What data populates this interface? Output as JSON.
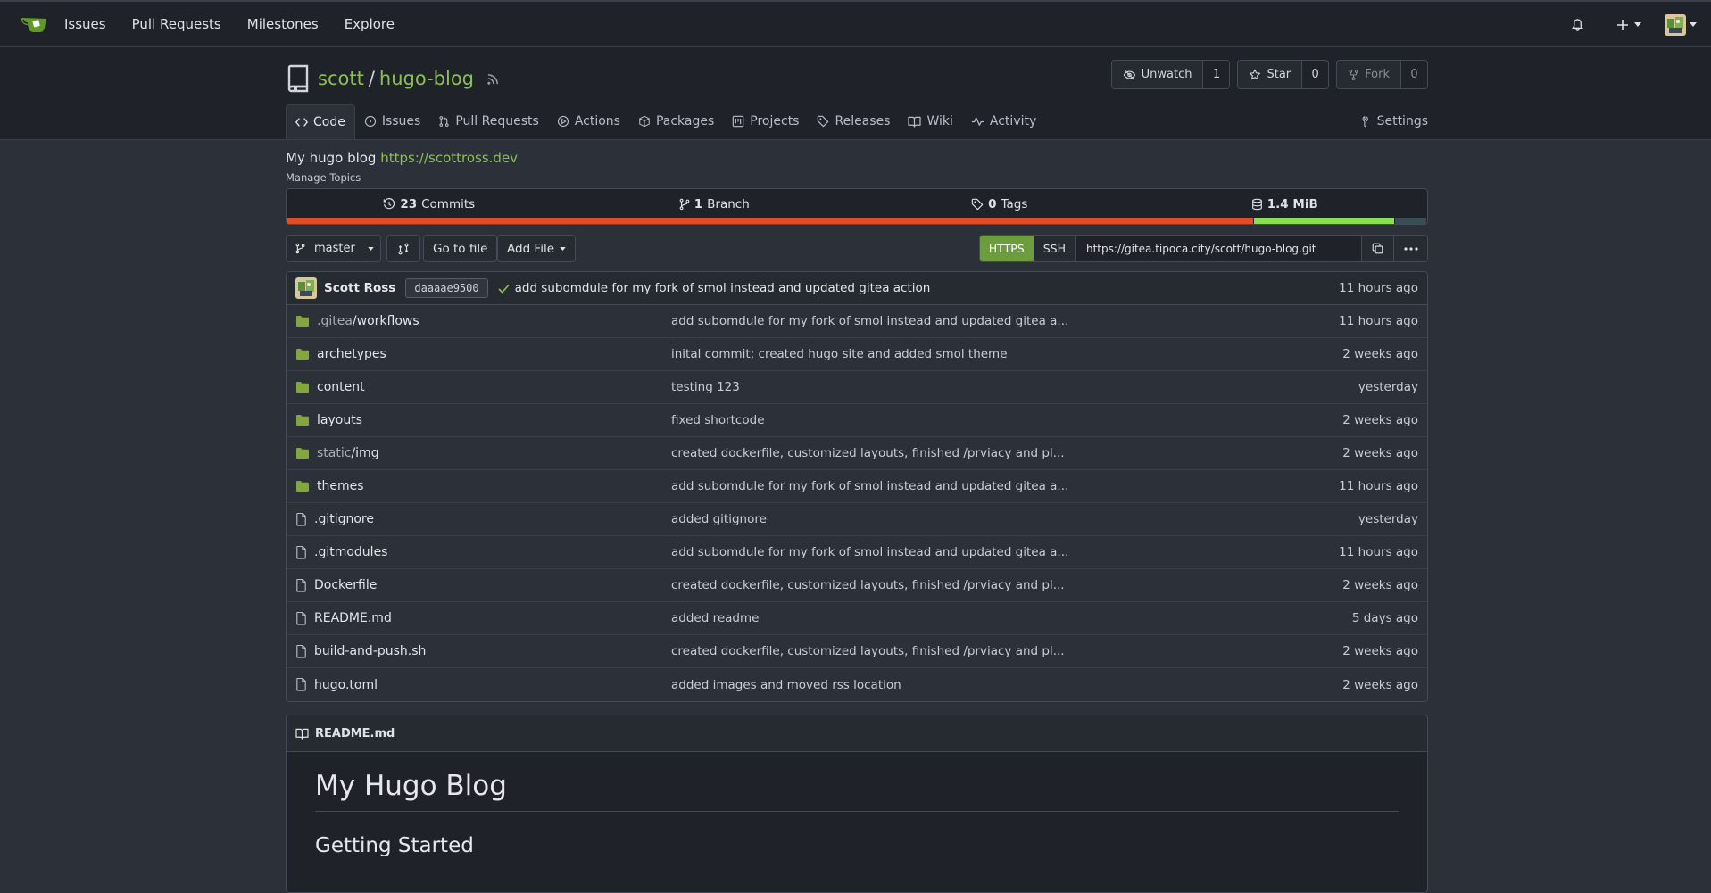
{
  "nav": {
    "links": [
      "Issues",
      "Pull Requests",
      "Milestones",
      "Explore"
    ]
  },
  "repo": {
    "owner": "scott",
    "separator": "/",
    "name": "hugo-blog",
    "watch": {
      "label": "Unwatch",
      "count": "1"
    },
    "star": {
      "label": "Star",
      "count": "0"
    },
    "fork": {
      "label": "Fork",
      "count": "0"
    },
    "tabs": [
      {
        "label": "Code",
        "icon": "code-icon"
      },
      {
        "label": "Issues",
        "icon": "issue-icon"
      },
      {
        "label": "Pull Requests",
        "icon": "pull-request-icon"
      },
      {
        "label": "Actions",
        "icon": "play-icon"
      },
      {
        "label": "Packages",
        "icon": "package-icon"
      },
      {
        "label": "Projects",
        "icon": "project-icon"
      },
      {
        "label": "Releases",
        "icon": "tag-icon"
      },
      {
        "label": "Wiki",
        "icon": "book-icon"
      },
      {
        "label": "Activity",
        "icon": "pulse-icon"
      }
    ],
    "settings_label": "Settings",
    "description": "My hugo blog",
    "website": "https://scottross.dev",
    "manage_topics": "Manage Topics"
  },
  "stats": {
    "commits_count": "23",
    "commits_label": "Commits",
    "branch_count": "1",
    "branch_label": "Branch",
    "tags_count": "0",
    "tags_label": "Tags",
    "size": "1.4 MiB"
  },
  "languages": [
    {
      "color": "#e34c26",
      "fraction": 0.848
    },
    {
      "color": "#89e051",
      "fraction": 0.124
    },
    {
      "color": "#384d54",
      "fraction": 0.028
    }
  ],
  "toolbar": {
    "branch": "master",
    "go_to_file": "Go to file",
    "add_file": "Add File",
    "https": "HTTPS",
    "ssh": "SSH",
    "clone_url": "https://gitea.tipoca.city/scott/hugo-blog.git"
  },
  "latest_commit": {
    "author": "Scott Ross",
    "sha": "daaaae9500",
    "message": "add subomdule for my fork of smol instead and updated gitea action",
    "time": "11 hours ago"
  },
  "files": [
    {
      "type": "dir",
      "prefix": ".gitea",
      "name": "/workflows",
      "message": "add subomdule for my fork of smol instead and updated gitea a...",
      "time": "11 hours ago"
    },
    {
      "type": "dir",
      "prefix": "",
      "name": "archetypes",
      "message": "inital commit; created hugo site and added smol theme",
      "time": "2 weeks ago"
    },
    {
      "type": "dir",
      "prefix": "",
      "name": "content",
      "message": "testing 123",
      "time": "yesterday"
    },
    {
      "type": "dir",
      "prefix": "",
      "name": "layouts",
      "message": "fixed shortcode",
      "time": "2 weeks ago"
    },
    {
      "type": "dir",
      "prefix": "static",
      "name": "/img",
      "message": "created dockerfile, customized layouts, finished /prviacy and pl...",
      "time": "2 weeks ago"
    },
    {
      "type": "dir",
      "prefix": "",
      "name": "themes",
      "message": "add subomdule for my fork of smol instead and updated gitea a...",
      "time": "11 hours ago"
    },
    {
      "type": "file",
      "prefix": "",
      "name": ".gitignore",
      "message": "added gitignore",
      "time": "yesterday"
    },
    {
      "type": "file",
      "prefix": "",
      "name": ".gitmodules",
      "message": "add subomdule for my fork of smol instead and updated gitea a...",
      "time": "11 hours ago"
    },
    {
      "type": "file",
      "prefix": "",
      "name": "Dockerfile",
      "message": "created dockerfile, customized layouts, finished /prviacy and pl...",
      "time": "2 weeks ago"
    },
    {
      "type": "file",
      "prefix": "",
      "name": "README.md",
      "message": "added readme",
      "time": "5 days ago"
    },
    {
      "type": "file",
      "prefix": "",
      "name": "build-and-push.sh",
      "message": "created dockerfile, customized layouts, finished /prviacy and pl...",
      "time": "2 weeks ago"
    },
    {
      "type": "file",
      "prefix": "",
      "name": "hugo.toml",
      "message": "added images and moved rss location",
      "time": "2 weeks ago"
    }
  ],
  "readme": {
    "filename": "README.md",
    "h1": "My Hugo Blog",
    "h2": "Getting Started"
  }
}
